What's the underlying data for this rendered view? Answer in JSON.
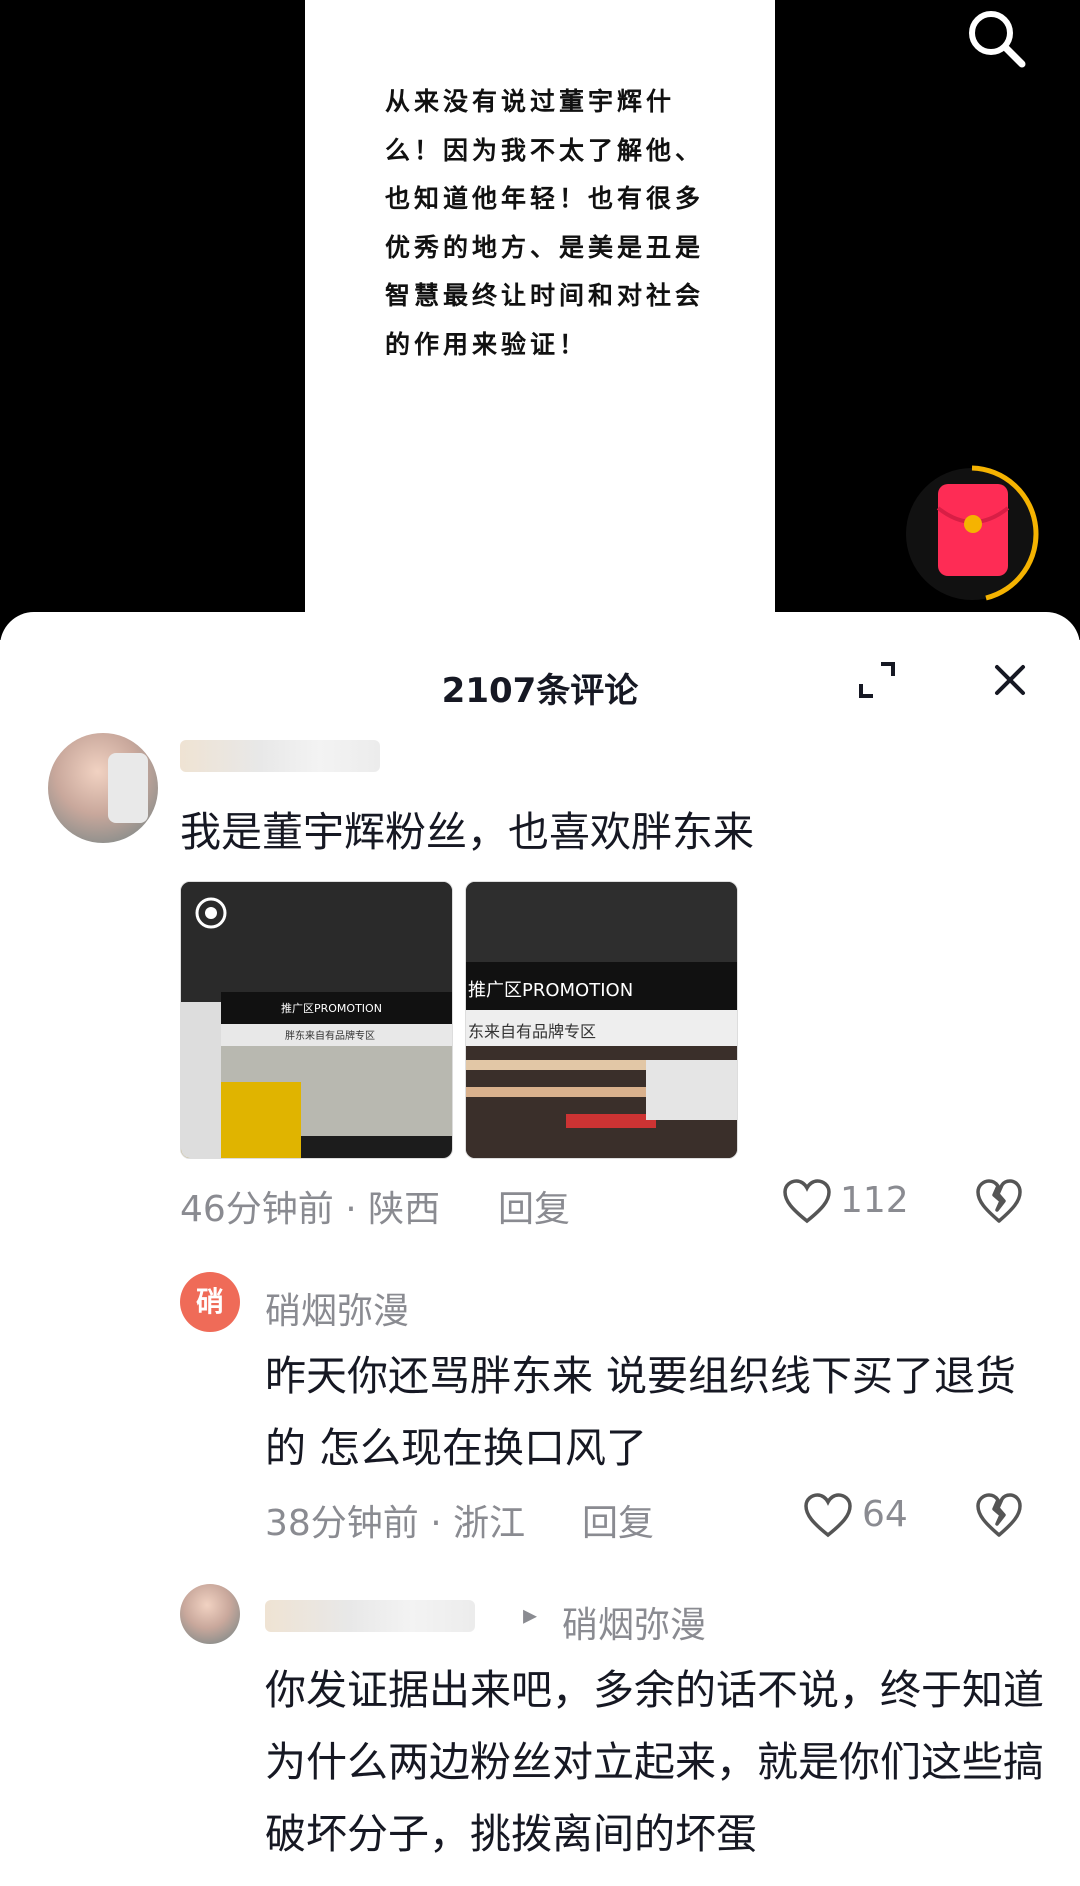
{
  "video": {
    "text": "从来没有说过董宇辉什么！因为我不太了解他、也知道他年轻！也有很多优秀的地方、是美是丑是智慧最终让时间和对社会的作用来验证！"
  },
  "sheet": {
    "title": "2107条评论"
  },
  "comments": [
    {
      "text": "我是董宇辉粉丝，也喜欢胖东来",
      "time_location": "46分钟前 · 陕西",
      "reply_label": "回复",
      "likes": "112",
      "images": [
        {
          "banner": "推广区PROMOTION",
          "sign": "胖东来自有品牌专区"
        },
        {
          "banner": "推广区PROMOTION",
          "sign": "东来自有品牌专区"
        }
      ]
    },
    {
      "avatar_char": "硝",
      "username": "硝烟弥漫",
      "text": "昨天你还骂胖东来 说要组织线下买了退货的 怎么现在换口风了",
      "time_location": "38分钟前 · 浙江",
      "reply_label": "回复",
      "likes": "64"
    },
    {
      "reply_to_arrow": "▸",
      "reply_to": "硝烟弥漫",
      "text": "你发证据出来吧，多余的话不说，终于知道为什么两边粉丝对立起来，就是你们这些搞破坏分子，挑拨离间的坏蛋"
    }
  ],
  "colors": {
    "accent": "#fe2c55",
    "gold": "#f5b301",
    "meta": "#8a8b91"
  }
}
